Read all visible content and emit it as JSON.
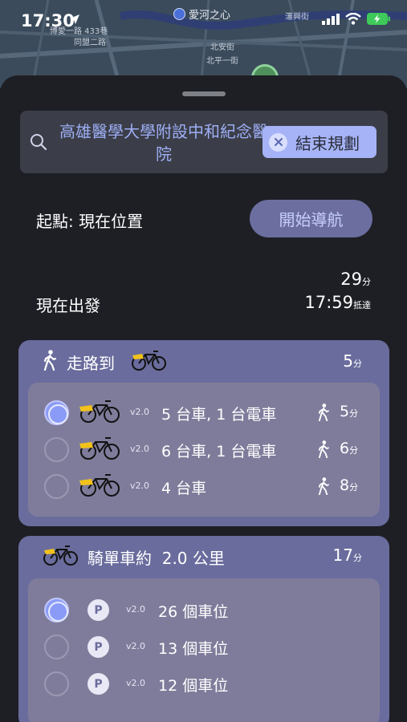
{
  "status_bar": {
    "time": "17:30",
    "icons": [
      "location-arrow-icon",
      "cellular-signal-icon",
      "wifi-icon",
      "battery-charging-icon"
    ]
  },
  "map": {
    "poi_name": "愛河之心",
    "labels": [
      "博愛一路 433巷",
      "同盟二路",
      "北安街",
      "北平一街",
      "瀋興街"
    ]
  },
  "search": {
    "destination": "高雄醫學大學附設中和紀念醫院",
    "end_button": "結束規劃"
  },
  "origin": {
    "label": "起點: 現在位置",
    "nav_button": "開始導航"
  },
  "departure": {
    "label": "現在出發",
    "duration_value": "29",
    "duration_unit": "分",
    "arrival_time": "17:59",
    "arrival_unit": "抵達"
  },
  "walk_card": {
    "title": "走路到",
    "duration_value": "5",
    "duration_unit": "分",
    "options": [
      {
        "version": "v2.0",
        "text": "5 台車, 1 台電車",
        "walk_value": "5",
        "walk_unit": "分",
        "selected": true
      },
      {
        "version": "v2.0",
        "text": "6 台車, 1 台電車",
        "walk_value": "6",
        "walk_unit": "分",
        "selected": false
      },
      {
        "version": "v2.0",
        "text": "4 台車",
        "walk_value": "8",
        "walk_unit": "分",
        "selected": false
      }
    ]
  },
  "ride_card": {
    "title": "騎單車約  2.0 公里",
    "duration_value": "17",
    "duration_unit": "分",
    "options": [
      {
        "badge": "P",
        "version": "v2.0",
        "text": "26 個車位",
        "selected": true
      },
      {
        "badge": "P",
        "version": "v2.0",
        "text": "13 個車位",
        "selected": false
      },
      {
        "badge": "P",
        "version": "v2.0",
        "text": "12 個車位",
        "selected": false
      }
    ]
  },
  "colors": {
    "sheet_bg": "#1e1f25",
    "card_bg": "#6a6c9d",
    "inner_bg": "#7f7c9b",
    "accent": "#a6b3f6",
    "bike_yellow": "#f2c21b"
  }
}
